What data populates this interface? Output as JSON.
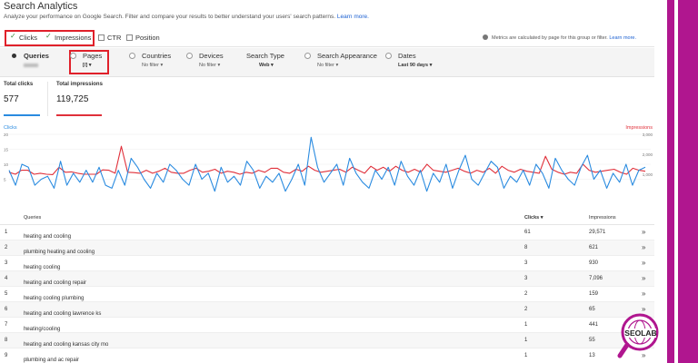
{
  "page": {
    "title": "Search Analytics",
    "subtitle": "Analyze your performance on Google Search. Filter and compare your results to better understand your users' search patterns.",
    "learn_more": "Learn more."
  },
  "metrics": {
    "clicks": "Clicks",
    "impressions": "Impressions",
    "ctr": "CTR",
    "position": "Position",
    "note": "Metrics are calculated by page for this group or filter.",
    "note_link": "Learn more."
  },
  "filters": [
    {
      "label": "Queries",
      "value": ""
    },
    {
      "label": "Pages",
      "value": "[/]"
    },
    {
      "label": "Countries",
      "value": "No filter"
    },
    {
      "label": "Devices",
      "value": "No filter"
    },
    {
      "label": "Search Type",
      "value": "Web"
    },
    {
      "label": "Search Appearance",
      "value": "No filter"
    },
    {
      "label": "Dates",
      "value": "Last 90 days"
    }
  ],
  "totals": {
    "clicks_label": "Total clicks",
    "clicks_value": "577",
    "impressions_label": "Total impressions",
    "impressions_value": "119,725"
  },
  "colors": {
    "clicks": "#2a8be0",
    "impressions": "#e0303a",
    "highlight": "#e0202a",
    "brand": "#b0168f"
  },
  "chart_data": {
    "type": "line",
    "y_left_label": "Clicks",
    "y_right_label": "Impressions",
    "y_left_ticks": [
      "20",
      "15",
      "10",
      "5"
    ],
    "y_right_ticks": [
      "3,000",
      "2,000",
      "1,000"
    ],
    "y_left_lim": [
      0,
      20
    ],
    "y_right_lim": [
      0,
      3000
    ],
    "series": [
      {
        "name": "Clicks",
        "values": [
          8,
          3,
          10,
          9,
          3,
          5,
          6,
          2,
          11,
          3,
          7,
          4,
          8,
          4,
          9,
          3,
          2,
          8,
          3,
          12,
          9,
          5,
          2,
          7,
          4,
          10,
          8,
          5,
          3,
          10,
          5,
          7,
          1,
          9,
          4,
          6,
          3,
          11,
          8,
          2,
          6,
          4,
          7,
          1,
          5,
          10,
          3,
          19,
          9,
          4,
          7,
          10,
          3,
          12,
          7,
          4,
          2,
          8,
          5,
          9,
          3,
          11,
          6,
          3,
          8,
          1,
          7,
          4,
          10,
          2,
          8,
          13,
          5,
          3,
          7,
          11,
          9,
          2,
          6,
          4,
          8,
          3,
          10,
          7,
          2,
          12,
          8,
          5,
          3,
          9,
          13,
          5,
          8,
          2,
          7,
          4,
          10,
          3,
          8,
          9
        ]
      },
      {
        "name": "Impressions",
        "values": [
          1100,
          1000,
          1200,
          1200,
          1000,
          1050,
          1000,
          980,
          1350,
          1100,
          1120,
          1050,
          1000,
          1000,
          1000,
          1220,
          1200,
          1050,
          2400,
          1100,
          1080,
          1050,
          1200,
          1050,
          1150,
          1300,
          1100,
          1050,
          1050,
          1200,
          1300,
          1100,
          1150,
          1250,
          1050,
          1150,
          1100,
          1000,
          1100,
          1050,
          1200,
          1100,
          1300,
          1300,
          1100,
          1050,
          1250,
          1150,
          1400,
          1200,
          1100,
          1150,
          1200,
          1250,
          1100,
          1350,
          1200,
          1050,
          1400,
          1200,
          1350,
          1150,
          1400,
          1200,
          1100,
          1250,
          1100,
          1500,
          1200,
          1150,
          1100,
          1200,
          1300,
          1150,
          1050,
          1200,
          1100,
          1300,
          1050,
          1400,
          1200,
          1100,
          1250,
          1150,
          1100,
          1050,
          1900,
          1250,
          1100,
          1000,
          1100,
          1050,
          1500,
          1200,
          1100,
          1150,
          1200,
          1250,
          1100,
          1000,
          1300,
          1200,
          1150
        ]
      }
    ]
  },
  "table": {
    "headers": {
      "num": "",
      "query": "Queries",
      "clicks": "Clicks ▾",
      "impressions": "Impressions"
    },
    "rows": [
      {
        "num": "1",
        "query": "heating and cooling",
        "clicks": "61",
        "impressions": "29,571"
      },
      {
        "num": "2",
        "query": "plumbing heating and cooling",
        "clicks": "8",
        "impressions": "621"
      },
      {
        "num": "3",
        "query": "heating cooling",
        "clicks": "3",
        "impressions": "930"
      },
      {
        "num": "4",
        "query": "heating and cooling repair",
        "clicks": "3",
        "impressions": "7,096"
      },
      {
        "num": "5",
        "query": "heating cooling plumbing",
        "clicks": "2",
        "impressions": "159"
      },
      {
        "num": "6",
        "query": "heating and cooling lawrence ks",
        "clicks": "2",
        "impressions": "65"
      },
      {
        "num": "7",
        "query": "heating/cooling",
        "clicks": "1",
        "impressions": "441"
      },
      {
        "num": "8",
        "query": "heating and cooling kansas city mo",
        "clicks": "1",
        "impressions": "55"
      },
      {
        "num": "9",
        "query": "plumbing and ac repair",
        "clicks": "1",
        "impressions": "13"
      }
    ]
  },
  "logo": {
    "text": "SEOLAB"
  }
}
